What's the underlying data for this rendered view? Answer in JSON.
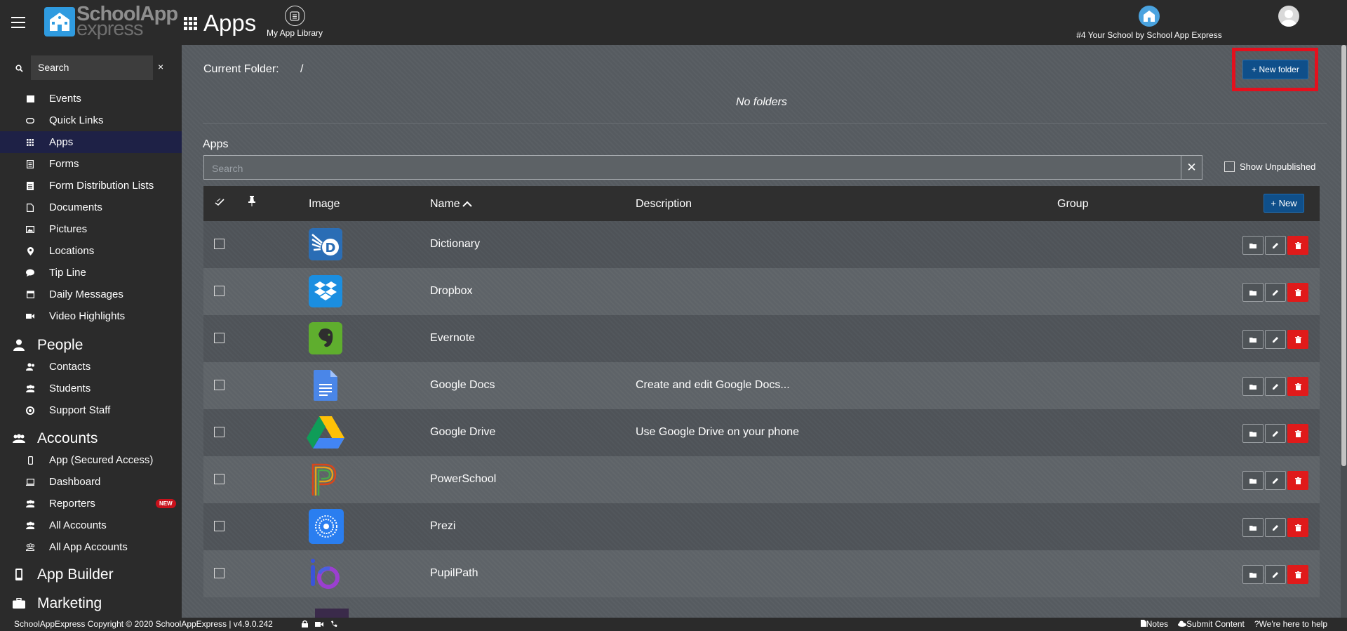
{
  "topbar": {
    "title": "Apps",
    "my_app_library": "My App Library",
    "school_name": "#4 Your School by School App Express",
    "logo_line1": "SchoolApp",
    "logo_line2": "express"
  },
  "sidebar": {
    "search_placeholder": "Search",
    "close": "×",
    "items": [
      {
        "label": "Events",
        "icon": "calendar-icon"
      },
      {
        "label": "Quick Links",
        "icon": "link-icon"
      },
      {
        "label": "Apps",
        "icon": "grid-icon",
        "active": true
      },
      {
        "label": "Forms",
        "icon": "form-icon"
      },
      {
        "label": "Form Distribution Lists",
        "icon": "list-icon"
      },
      {
        "label": "Documents",
        "icon": "document-icon"
      },
      {
        "label": "Pictures",
        "icon": "picture-icon"
      },
      {
        "label": "Locations",
        "icon": "location-pin-icon"
      },
      {
        "label": "Tip Line",
        "icon": "chat-icon"
      },
      {
        "label": "Daily Messages",
        "icon": "calendar-icon"
      },
      {
        "label": "Video Highlights",
        "icon": "video-icon"
      }
    ],
    "people_heading": "People",
    "people_items": [
      {
        "label": "Contacts",
        "icon": "contacts-icon"
      },
      {
        "label": "Students",
        "icon": "students-icon"
      },
      {
        "label": "Support Staff",
        "icon": "support-icon"
      }
    ],
    "accounts_heading": "Accounts",
    "accounts_items": [
      {
        "label": "App (Secured Access)",
        "icon": "phone-icon"
      },
      {
        "label": "Dashboard",
        "icon": "laptop-icon"
      },
      {
        "label": "Reporters",
        "icon": "users-icon",
        "badge": "NEW"
      },
      {
        "label": "All Accounts",
        "icon": "users-icon"
      },
      {
        "label": "All App Accounts",
        "icon": "users-outline-icon"
      }
    ],
    "app_builder_heading": "App Builder",
    "marketing_heading": "Marketing"
  },
  "main": {
    "current_folder_label": "Current Folder:",
    "current_folder_value": "/",
    "new_folder_button": "+ New folder",
    "no_folders": "No folders",
    "apps_label": "Apps",
    "search_placeholder": "Search",
    "show_unpublished": "Show Unpublished",
    "new_button": "+ New",
    "columns": {
      "image": "Image",
      "name": "Name",
      "description": "Description",
      "group": "Group"
    },
    "rows": [
      {
        "name": "Dictionary",
        "description": "",
        "icon": "dictionary-icon"
      },
      {
        "name": "Dropbox",
        "description": "",
        "icon": "dropbox-icon"
      },
      {
        "name": "Evernote",
        "description": "",
        "icon": "evernote-icon"
      },
      {
        "name": "Google Docs",
        "description": "Create and edit Google Docs...",
        "icon": "google-docs-icon"
      },
      {
        "name": "Google Drive",
        "description": "Use Google Drive on your phone",
        "icon": "google-drive-icon"
      },
      {
        "name": "PowerSchool",
        "description": "",
        "icon": "powerschool-icon"
      },
      {
        "name": "Prezi",
        "description": "",
        "icon": "prezi-icon"
      },
      {
        "name": "PupilPath",
        "description": "",
        "icon": "pupilpath-icon"
      }
    ]
  },
  "footer": {
    "copyright": "SchoolAppExpress Copyright © 2020 SchoolAppExpress | v4.9.0.242",
    "notes": "Notes",
    "submit_content": "Submit Content",
    "help": "We're here to help"
  },
  "colors": {
    "accent": "#0f4f8a",
    "highlight_box": "#e4101d",
    "delete": "#e01a1a",
    "active_nav": "#1e2146"
  }
}
